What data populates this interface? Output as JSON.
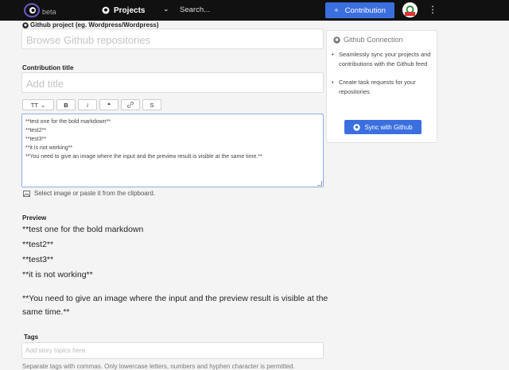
{
  "header": {
    "beta": "beta",
    "projects_label": "Projects",
    "search_placeholder": "Search...",
    "contribution_label": "Contribution",
    "contribution_plus": "+"
  },
  "form": {
    "github_project_label": "Github project (eg. Wordpress/Wordpress)",
    "github_project_placeholder": "Browse Github repositories",
    "title_label": "Contribution title",
    "title_placeholder": "Add title",
    "toolbar": {
      "heading": "TT",
      "bold": "B",
      "italic": "i",
      "quote": "❝",
      "link": "🔗",
      "code": "S"
    },
    "editor_lines": [
      "**test one for the bold markdown**",
      "**test2**",
      "**test3**",
      "**it is not working**",
      "**You need to give an image where the input and the preview result is visible at the same time.**"
    ],
    "image_hint": "Select image or paste it from the clipboard.",
    "preview_label": "Preview",
    "preview_lines": [
      "**test one for the bold markdown",
      "**test2**",
      "**test3**",
      "**it is not working**",
      "**You need to give an image where the input and the preview result is visible at the",
      "same time.**"
    ],
    "tags_label": "Tags",
    "tags_placeholder": "Add story topics here",
    "tags_help": "Separate tags with commas. Only lowercase letters, numbers and hyphen character is permitted."
  },
  "sidebar": {
    "title": "Github Connection",
    "items": [
      "Seamlessly sync your projects and contributions with the Github feed",
      "Create task requests for your repositories"
    ],
    "sync_label": "Sync with Github"
  },
  "colors": {
    "accent": "#3b6fe0",
    "topbar": "#111111"
  }
}
